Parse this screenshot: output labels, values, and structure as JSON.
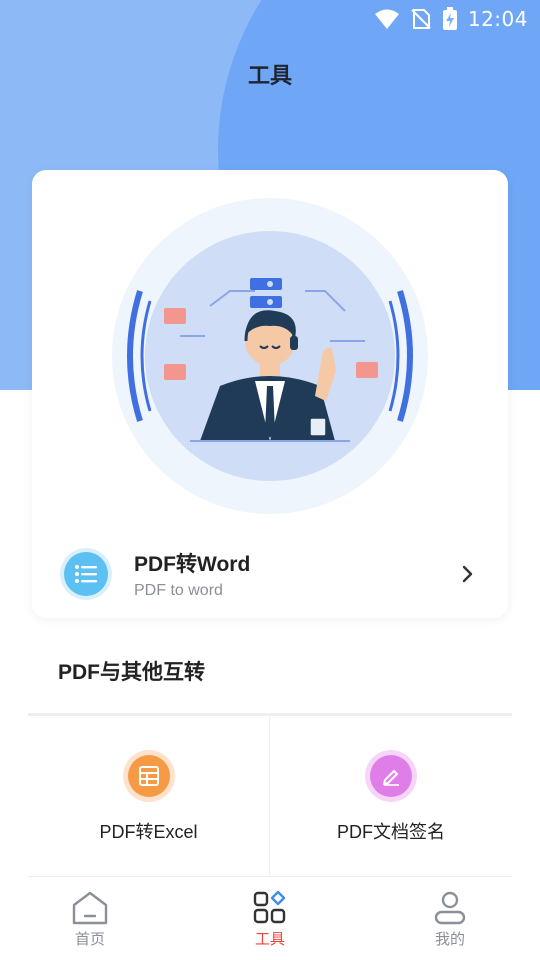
{
  "status_bar": {
    "time": "12:04",
    "icons": [
      "wifi-icon",
      "no-sim-icon",
      "battery-charging-icon"
    ]
  },
  "header": {
    "title": "工具"
  },
  "hero": {
    "illustration": "customer-service-illustration",
    "feature_title": "PDF转Word",
    "feature_subtitle": "PDF to word",
    "feature_icon": "list-icon"
  },
  "section": {
    "title": "PDF与其他互转",
    "tools": [
      {
        "label": "PDF转Excel",
        "icon": "table-icon",
        "color": "#f79a45"
      },
      {
        "label": "PDF文档签名",
        "icon": "pen-icon",
        "color": "#df7ee8"
      }
    ]
  },
  "bottom_nav": {
    "items": [
      {
        "label": "首页",
        "icon": "home-icon",
        "active": false
      },
      {
        "label": "工具",
        "icon": "tools-grid-icon",
        "active": true
      },
      {
        "label": "我的",
        "icon": "user-icon",
        "active": false
      }
    ],
    "active_color": "#f0453b",
    "inactive_color": "#8a8f98"
  },
  "colors": {
    "header_bg": "#8dbaf7",
    "header_circle": "#6fa6f6",
    "accent_blue": "#3f6fe0"
  }
}
